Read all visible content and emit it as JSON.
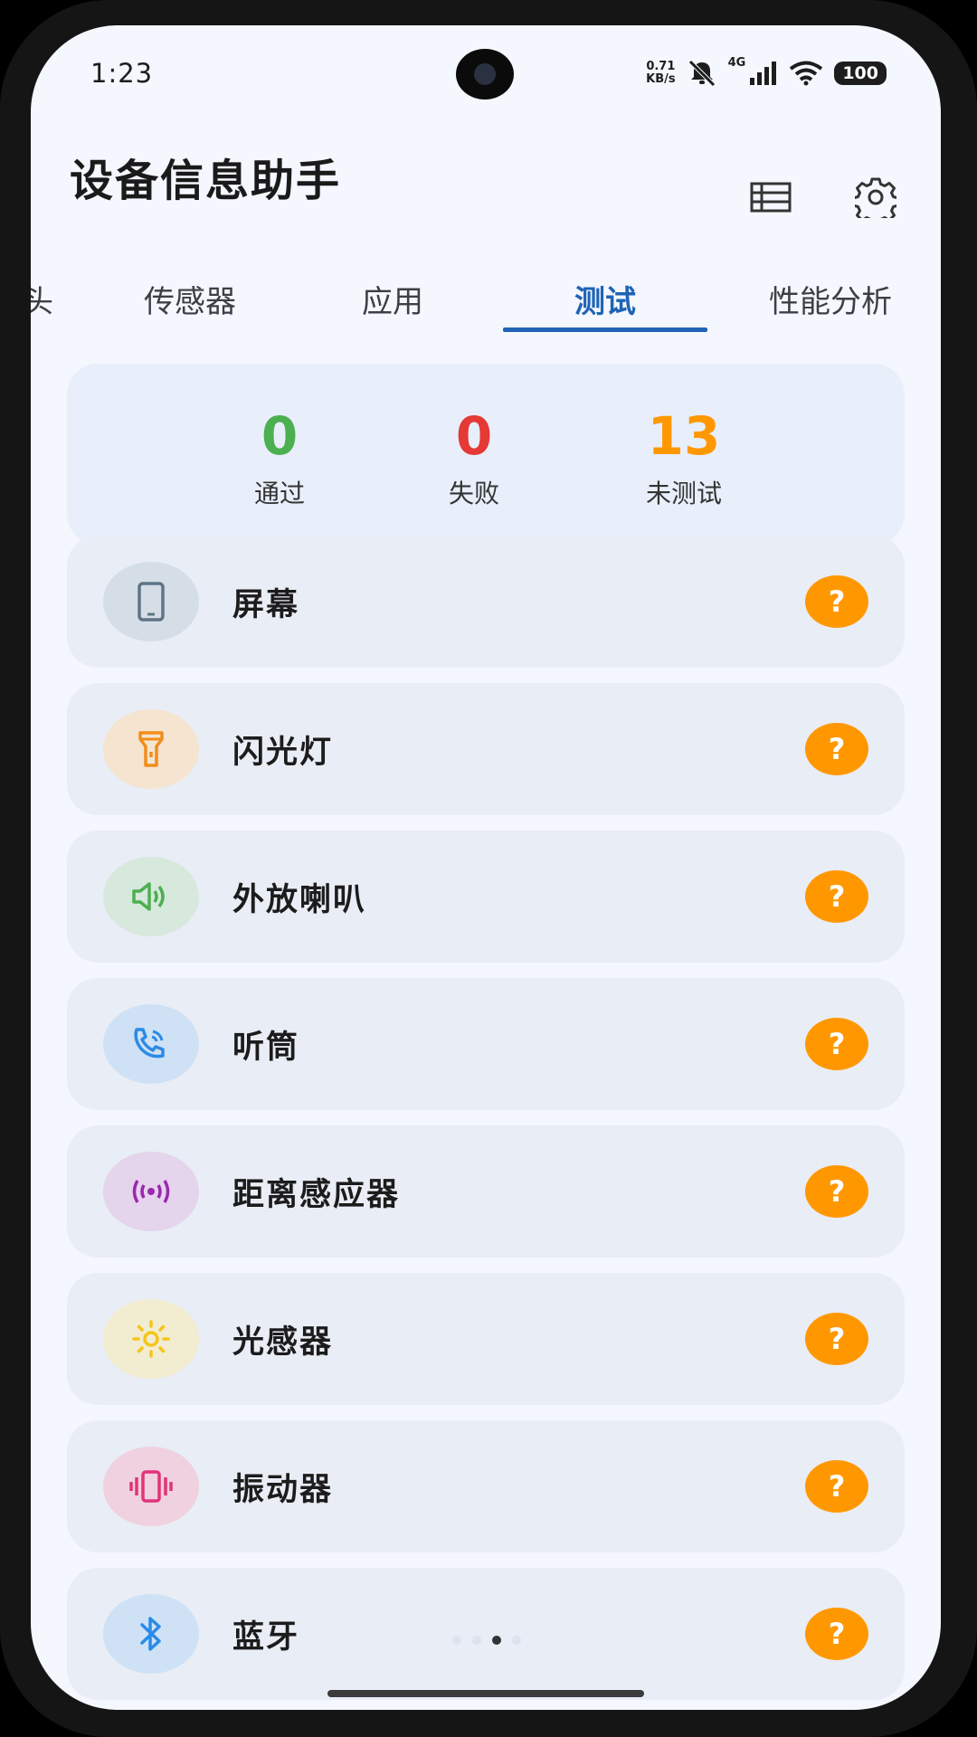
{
  "status_bar": {
    "time": "1:23",
    "net_speed_value": "0.71",
    "net_speed_unit": "KB/s",
    "network_type": "4G",
    "battery": "100"
  },
  "header": {
    "title": "设备信息助手",
    "list_icon": "list-icon",
    "settings_icon": "gear-icon"
  },
  "tabs": [
    {
      "label": "头"
    },
    {
      "label": "传感器"
    },
    {
      "label": "应用"
    },
    {
      "label": "测试",
      "active": true
    },
    {
      "label": "性能分析"
    }
  ],
  "summary": {
    "passed": {
      "value": "0",
      "label": "通过",
      "color": "#4CAF50"
    },
    "failed": {
      "value": "0",
      "label": "失败",
      "color": "#E53935"
    },
    "untested": {
      "value": "13",
      "label": "未测试",
      "color": "#FF9800"
    }
  },
  "tests": [
    {
      "label": "屏幕",
      "icon": "phone-icon",
      "icon_color": "#5f7585",
      "circle_color": "#D5DEE6",
      "status": "?"
    },
    {
      "label": "闪光灯",
      "icon": "flashlight-icon",
      "icon_color": "#F28C1B",
      "circle_color": "#F4E4D0",
      "status": "?"
    },
    {
      "label": "外放喇叭",
      "icon": "speaker-icon",
      "icon_color": "#4CAF50",
      "circle_color": "#D7E8DD",
      "status": "?"
    },
    {
      "label": "听筒",
      "icon": "phone-call-icon",
      "icon_color": "#2B8BE6",
      "circle_color": "#CFE1F5",
      "status": "?"
    },
    {
      "label": "距离感应器",
      "icon": "proximity-icon",
      "icon_color": "#9C27B0",
      "circle_color": "#E4D4EC",
      "status": "?"
    },
    {
      "label": "光感器",
      "icon": "sun-icon",
      "icon_color": "#F5C518",
      "circle_color": "#F2ECD0",
      "status": "?"
    },
    {
      "label": "振动器",
      "icon": "vibration-icon",
      "icon_color": "#E0347A",
      "circle_color": "#F0D1DF",
      "status": "?"
    },
    {
      "label": "蓝牙",
      "icon": "bluetooth-icon",
      "icon_color": "#2B8BE6",
      "circle_color": "#CFE1F5",
      "status": "?"
    }
  ],
  "accent_color": "#1f63b6"
}
